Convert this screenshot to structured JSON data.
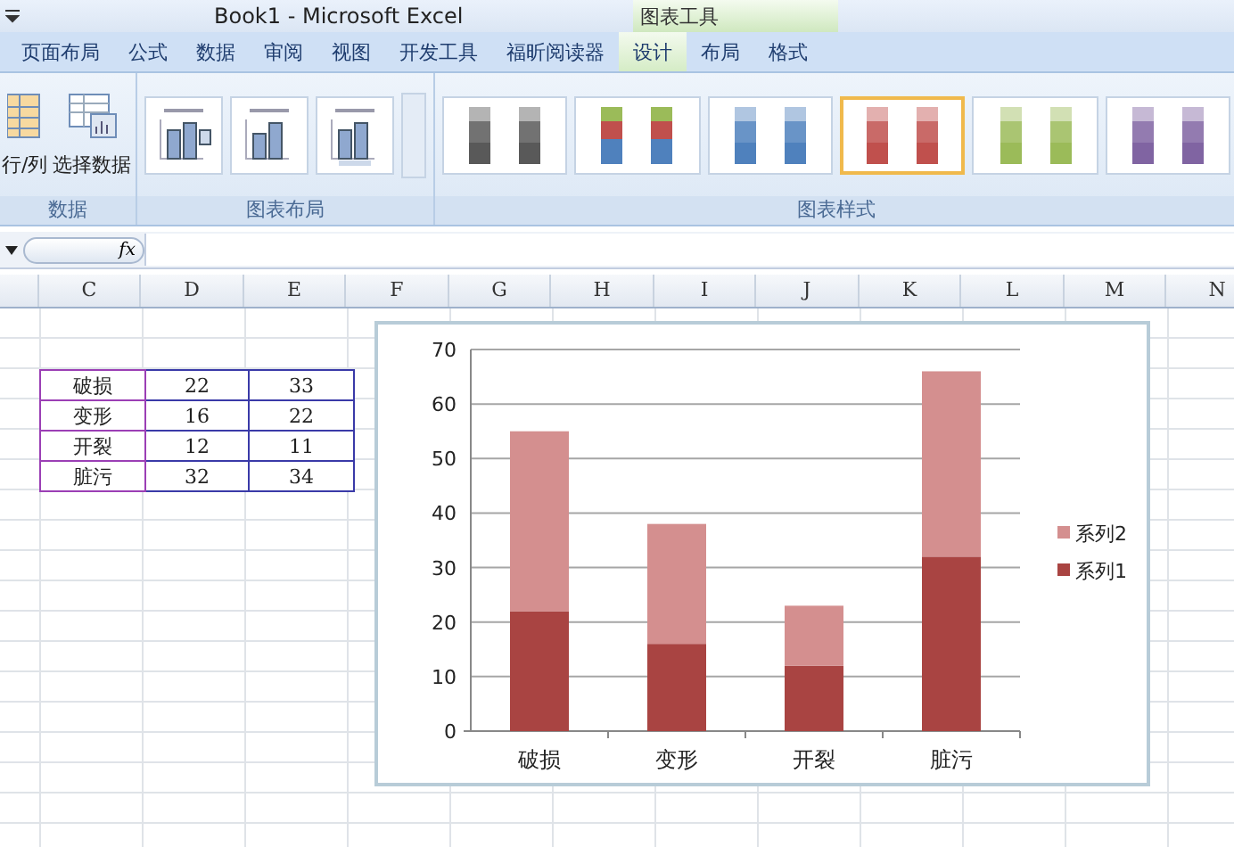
{
  "window": {
    "title": "Book1 - Microsoft Excel"
  },
  "context_tab_group": {
    "label": "图表工具"
  },
  "tabs": [
    {
      "label": "页面布局",
      "selected": false
    },
    {
      "label": "公式",
      "selected": false
    },
    {
      "label": "数据",
      "selected": false
    },
    {
      "label": "审阅",
      "selected": false
    },
    {
      "label": "视图",
      "selected": false
    },
    {
      "label": "开发工具",
      "selected": false
    },
    {
      "label": "福昕阅读器",
      "selected": false
    },
    {
      "label": "设计",
      "selected": true
    },
    {
      "label": "布局",
      "selected": false
    },
    {
      "label": "格式",
      "selected": false
    }
  ],
  "ribbon": {
    "groups": [
      {
        "kind": "buttons",
        "label": "数据",
        "buttons": [
          "行/列",
          "选择数据"
        ]
      },
      {
        "kind": "layouts",
        "label": "图表布局",
        "layouts": [
          {
            "selected": false
          },
          {
            "selected": false
          },
          {
            "selected": false
          }
        ]
      },
      {
        "kind": "styles",
        "label": "图表样式",
        "styles": [
          {
            "kind": "mono",
            "color": "#595959",
            "selected": false
          },
          {
            "kind": "multi",
            "color": "#4f81bd",
            "selected": false
          },
          {
            "kind": "mono",
            "color": "#4f81bd",
            "selected": false
          },
          {
            "kind": "mono",
            "color": "#c0504d",
            "selected": true
          },
          {
            "kind": "mono",
            "color": "#9bbb59",
            "selected": false
          },
          {
            "kind": "mono",
            "color": "#8064a2",
            "selected": false
          }
        ]
      }
    ]
  },
  "formula_bar": {
    "fx": "fx"
  },
  "columns": [
    "C",
    "D",
    "E",
    "F",
    "G",
    "H",
    "I",
    "J",
    "K",
    "L",
    "M",
    "N"
  ],
  "table": [
    [
      "破损",
      "22",
      "33"
    ],
    [
      "变形",
      "16",
      "22"
    ],
    [
      "开裂",
      "12",
      "11"
    ],
    [
      "脏污",
      "32",
      "34"
    ]
  ],
  "chart": {
    "chart_data": {
      "type": "bar",
      "stacked": true,
      "grid": true,
      "legend": true,
      "categories": [
        "破损",
        "变形",
        "开裂",
        "脏污"
      ],
      "ylim": [
        0,
        70
      ],
      "yticks": [
        0,
        10,
        20,
        30,
        40,
        50,
        60,
        70
      ],
      "series": [
        {
          "name": "系列1",
          "color": "#a94442",
          "values": [
            22,
            16,
            12,
            32
          ]
        },
        {
          "name": "系列2",
          "color": "#d48f8f",
          "values": [
            33,
            22,
            11,
            34
          ]
        }
      ]
    }
  }
}
